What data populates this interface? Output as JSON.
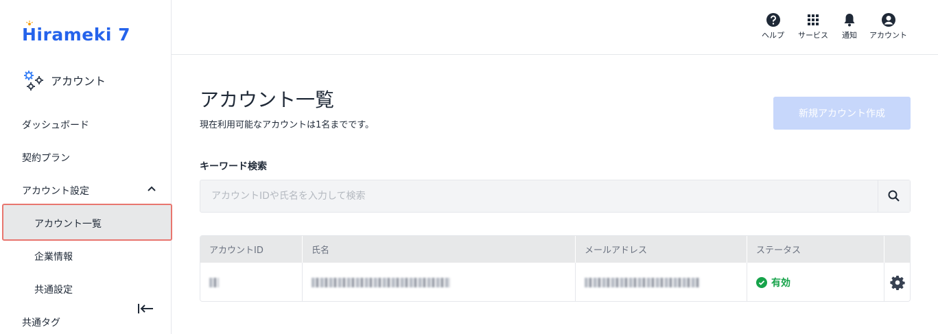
{
  "brand": {
    "logo_text": "Hirameki 7",
    "accent": "#2563eb"
  },
  "app": {
    "title": "アカウント"
  },
  "sidebar": {
    "items": [
      {
        "label": "ダッシュボード"
      },
      {
        "label": "契約プラン"
      },
      {
        "label": "アカウント設定"
      },
      {
        "label": "共通タグ"
      }
    ],
    "subitems": [
      {
        "label": "アカウント一覧"
      },
      {
        "label": "企業情報"
      },
      {
        "label": "共通設定"
      }
    ]
  },
  "header": {
    "help": "ヘルプ",
    "services": "サービス",
    "notifications": "通知",
    "account": "アカウント"
  },
  "main": {
    "title": "アカウント一覧",
    "description": "現在利用可能なアカウントは1名までです。",
    "create_button": "新規アカウント作成",
    "search_label": "キーワード検索",
    "search_placeholder": "アカウントIDや氏名を入力して検索"
  },
  "table": {
    "columns": [
      "アカウントID",
      "氏名",
      "メールアドレス",
      "ステータス"
    ],
    "rows": [
      {
        "status": "有効"
      }
    ]
  },
  "colors": {
    "status_active": "#16a34a",
    "active_border": "#e8756e",
    "create_button_bg": "#c7d7fb"
  }
}
